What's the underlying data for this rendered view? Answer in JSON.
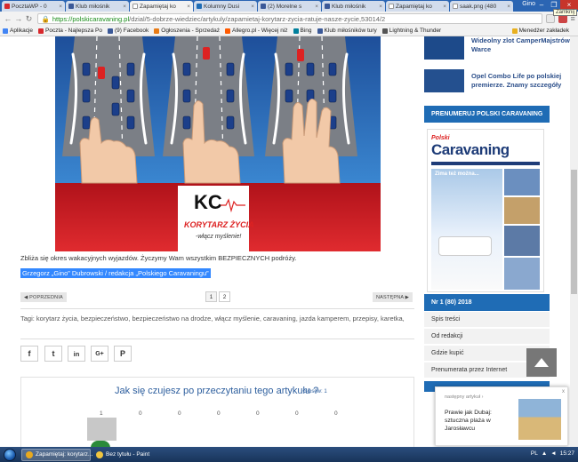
{
  "browser": {
    "tabs": [
      {
        "label": "PocztaWP - 0",
        "color": "#d8282c",
        "active": false
      },
      {
        "label": "Klub miłośnik",
        "color": "#3b5998",
        "active": false
      },
      {
        "label": "Zapamiętaj ko",
        "color": "#ffffff",
        "active": true
      },
      {
        "label": "Kolumny Dusi",
        "color": "#1f6cb5",
        "active": false
      },
      {
        "label": "(2) Morelne s",
        "color": "#3b5998",
        "active": false
      },
      {
        "label": "Klub miłośnik",
        "color": "#3b5998",
        "active": false
      },
      {
        "label": "Zapamiętaj ko",
        "color": "#ffffff",
        "active": false
      },
      {
        "label": "saak.png (480",
        "color": "#ffffff",
        "active": false
      }
    ],
    "user": "Gino",
    "tooltip": "Zamknij",
    "address": {
      "host": "https://polskicaravaning.pl",
      "path": "/dzial/5-dobrze-wiedziec/artykuly/zapamietaj-korytarz-zycia-ratuje-nasze-zycie,53014/2"
    },
    "bookmarks": [
      {
        "label": "Aplikacje",
        "color": "#4285f4"
      },
      {
        "label": "Poczta - Najlepsza Po",
        "color": "#d8282c"
      },
      {
        "label": "(9) Facebook",
        "color": "#3b5998"
      },
      {
        "label": "Ogłoszenia - Sprzedaż",
        "color": "#e87b16"
      },
      {
        "label": "Allegro.pl - Więcej niż",
        "color": "#ff5a00"
      },
      {
        "label": "Bing",
        "color": "#00809d"
      },
      {
        "label": "Klub miłośników tury",
        "color": "#3b5998"
      },
      {
        "label": "Lightning & Thunder",
        "color": "#555555"
      }
    ],
    "bookmarks_other": "Menedżer zakładek"
  },
  "article": {
    "logo_letters": "KC",
    "logo_brand": "KORYTARZ ŻYCIA",
    "logo_slogan": "-włącz myślenie!",
    "intro": "Zbliża się okres wakacyjnych wyjazdów. Życzymy Wam wszystkim BEZPIECZNYCH podróży.",
    "author": "Grzegorz „Gino” Dubrowski / redakcja „Polskiego Caravaningu”",
    "prev_label": "◀ POPRZEDNIA",
    "next_label": "NASTĘPNA ▶",
    "pages": [
      "1",
      "2"
    ],
    "tags": "Tagi: korytarz życia, bezpieczeństwo, bezpieczeństwo na drodze, włącz myślenie, caravaning, jazda kamperem, przepisy, karetka,",
    "share": {
      "facebook": "f",
      "twitter": "t",
      "linkedin": "in",
      "google": "G+",
      "pinterest": "P"
    }
  },
  "poll": {
    "title": "Jak się czujesz po przeczytaniu tego artykułu ?",
    "votes": "Głosów: 1",
    "counts": [
      "1",
      "0",
      "0",
      "0",
      "0",
      "0",
      "0"
    ],
    "first_bar_fraction": 1
  },
  "sidebar": {
    "news": [
      {
        "title": "Wideolny zlot CamperMajstrów w Warce"
      },
      {
        "title": "Opel Combo Life po polskiej premierze. Znamy szczegóły"
      }
    ],
    "subscribe_heading": "PRENUMERUJ POLSKI CARAVANING",
    "cover": {
      "brand_top": "Polski",
      "brand_main": "Caravaning",
      "headline": "Zima też można..."
    },
    "issue_heading": "Nr 1 (80) 2018",
    "menu": [
      "Spis treści",
      "Od redakcji",
      "Gdzie kupić",
      "Prenumerata przez Internet"
    ]
  },
  "popup": {
    "small": "następny artykuł ›",
    "title": "Prawie jak Dubaj: sztuczna plaża w Jarosławcu",
    "close": "x"
  },
  "taskbar": {
    "tasks": [
      {
        "label": "Zapamiętaj: korytarz...",
        "color": "#e8a91e",
        "active": true
      },
      {
        "label": "Bez tytułu - Paint",
        "color": "#f0c540",
        "active": false
      }
    ],
    "tray_lang": "PL",
    "time": "15:27"
  }
}
